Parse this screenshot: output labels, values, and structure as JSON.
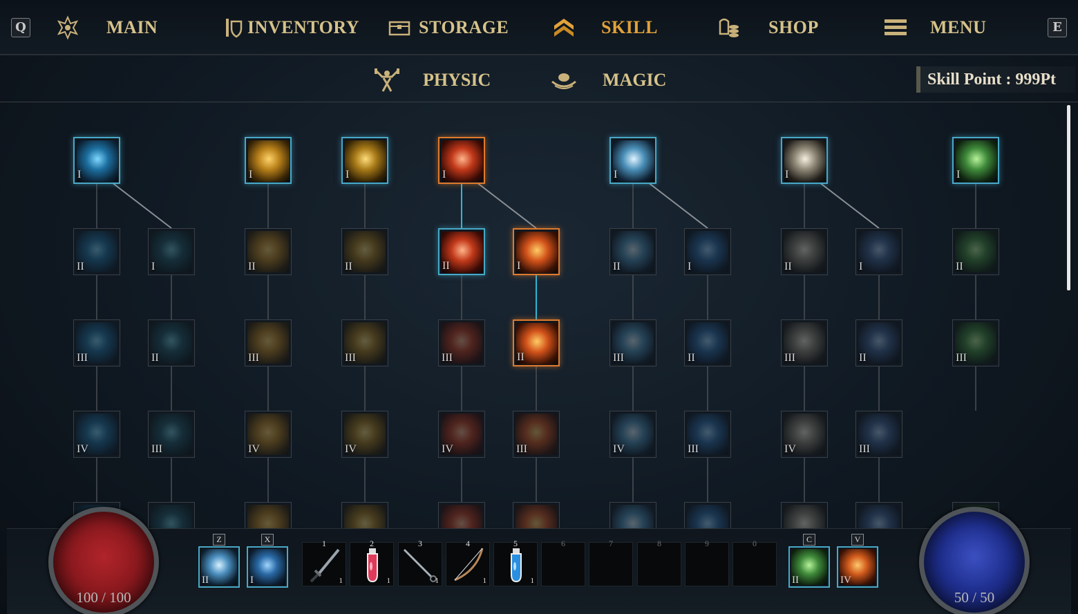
{
  "nav": {
    "left_key": "Q",
    "right_key": "E",
    "tabs": [
      {
        "label": "MAIN",
        "icon": "crest-icon"
      },
      {
        "label": "INVENTORY",
        "icon": "armor-icon"
      },
      {
        "label": "STORAGE",
        "icon": "chest-icon"
      },
      {
        "label": "SKILL",
        "icon": "chevron-rank-icon",
        "active": true
      },
      {
        "label": "SHOP",
        "icon": "coins-icon"
      },
      {
        "label": "MENU",
        "icon": "hamburger-icon"
      }
    ]
  },
  "subtabs": [
    {
      "label": "PHYSIC",
      "icon": "strongman-icon"
    },
    {
      "label": "MAGIC",
      "icon": "magic-hands-icon"
    }
  ],
  "skill_point": "Skill Point : 999Pt",
  "colors": {
    "accent": "#e1a23a",
    "nav_text": "#d6c28a",
    "select_blue": "#48a9c8",
    "select_orange": "#e07a2c",
    "hp": "#8d1a1f",
    "mp": "#1f2f8f"
  },
  "tree": {
    "columns": [
      {
        "theme": "atom-blue",
        "ranks": [
          "I",
          "II",
          "III",
          "IV"
        ],
        "lit": [
          0
        ]
      },
      {
        "theme": "meditate-teal",
        "ranks": [
          "I",
          "II",
          "III"
        ],
        "lit": []
      },
      {
        "theme": "gold-chest",
        "ranks": [
          "I",
          "II",
          "III",
          "IV"
        ],
        "lit": [
          0
        ]
      },
      {
        "theme": "gold-summon",
        "ranks": [
          "I",
          "II",
          "III",
          "IV"
        ],
        "lit": [
          0
        ]
      },
      {
        "theme": "fire-body",
        "ranks": [
          "I",
          "II",
          "III",
          "IV"
        ],
        "lit": [
          0,
          1
        ]
      },
      {
        "theme": "fire-bolt",
        "ranks": [
          "I",
          "II",
          "III"
        ],
        "lit": [
          0,
          1
        ]
      },
      {
        "theme": "ice-body",
        "ranks": [
          "I",
          "II",
          "III",
          "IV"
        ],
        "lit": [
          0
        ]
      },
      {
        "theme": "ice-cube",
        "ranks": [
          "I",
          "II",
          "III"
        ],
        "lit": []
      },
      {
        "theme": "spirit-white",
        "ranks": [
          "I",
          "II",
          "III",
          "IV"
        ],
        "lit": [
          0
        ]
      },
      {
        "theme": "storm-blade",
        "ranks": [
          "I",
          "II",
          "III"
        ],
        "lit": []
      },
      {
        "theme": "nature-green",
        "ranks": [
          "I",
          "II",
          "III"
        ],
        "lit": [
          0
        ]
      }
    ]
  },
  "hud": {
    "hp_text": "100 / 100",
    "mp_text": "50 / 50",
    "skills_left": [
      {
        "key": "Z",
        "rank": "II",
        "theme": "ice-shard"
      },
      {
        "key": "X",
        "rank": "I",
        "theme": "ice-cube"
      }
    ],
    "slots": [
      {
        "num": "1",
        "item": "sword-icon",
        "count": "1"
      },
      {
        "num": "2",
        "item": "red-potion-icon",
        "count": "1"
      },
      {
        "num": "3",
        "item": "rapier-icon",
        "count": "1"
      },
      {
        "num": "4",
        "item": "bow-icon",
        "count": "1"
      },
      {
        "num": "5",
        "item": "blue-potion-icon",
        "count": "1"
      },
      {
        "num": "6"
      },
      {
        "num": "7"
      },
      {
        "num": "8"
      },
      {
        "num": "9"
      },
      {
        "num": "0"
      }
    ],
    "skills_right": [
      {
        "key": "C",
        "rank": "II",
        "theme": "nature-green"
      },
      {
        "key": "V",
        "rank": "IV",
        "theme": "fire-vortex"
      }
    ]
  }
}
